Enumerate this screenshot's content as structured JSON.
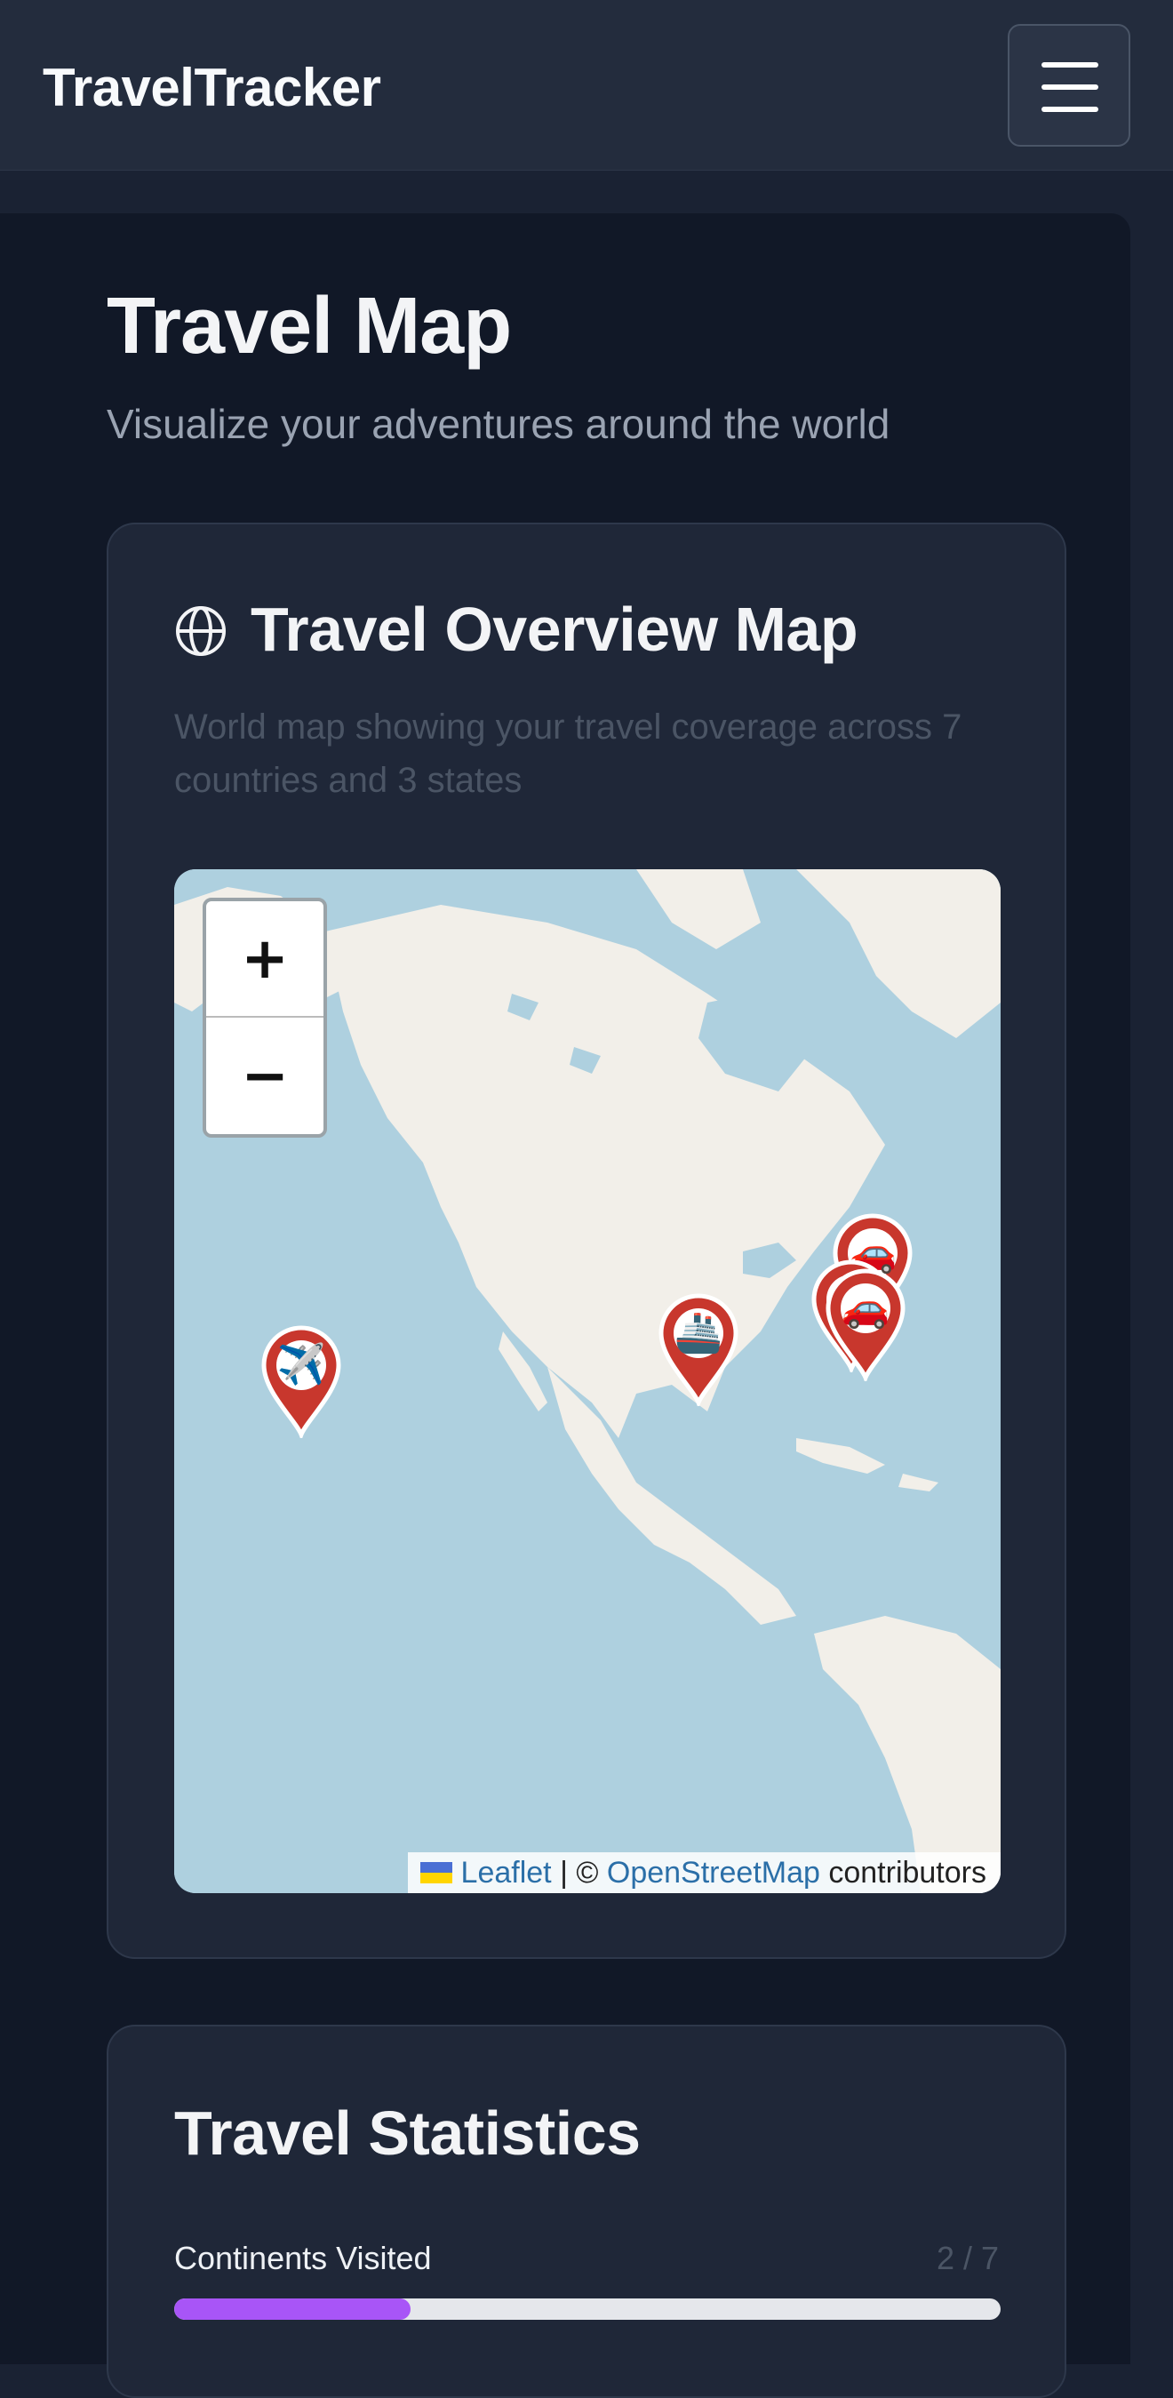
{
  "navbar": {
    "brand": "TravelTracker",
    "menu_icon": "hamburger-menu-icon"
  },
  "page": {
    "title": "Travel Map",
    "subtitle": "Visualize your adventures around the world"
  },
  "map_card": {
    "icon": "globe-icon",
    "title": "Travel Overview Map",
    "description": "World map showing your travel coverage across 7 countries and 3 states",
    "map": {
      "zoom_in_label": "+",
      "zoom_out_label": "−",
      "markers": [
        {
          "name": "marker-plane",
          "emoji": "✈️",
          "icon": "airplane-icon"
        },
        {
          "name": "marker-ship",
          "emoji": "🚢",
          "icon": "ship-icon"
        },
        {
          "name": "marker-car-1",
          "emoji": "🚗",
          "icon": "car-icon"
        },
        {
          "name": "marker-car-2",
          "emoji": "🚗",
          "icon": "car-icon"
        },
        {
          "name": "marker-car-3",
          "emoji": "🚗",
          "icon": "car-icon"
        }
      ],
      "attribution": {
        "leaflet": "Leaflet",
        "separator": " | © ",
        "osm": "OpenStreetMap",
        "contributors": " contributors"
      }
    },
    "colors": {
      "marker": "#c8372d",
      "water": "#aed0df",
      "land": "#f2efe9"
    }
  },
  "stats_card": {
    "title": "Travel Statistics",
    "rows": [
      {
        "label": "Continents Visited",
        "count": "2 / 7",
        "fraction": 0.2857,
        "color": "#a855f7"
      }
    ]
  }
}
